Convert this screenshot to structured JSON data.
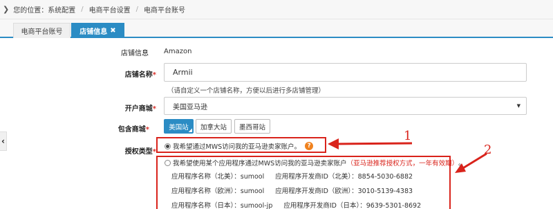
{
  "breadcrumb": {
    "prefix": "您的位置：",
    "items": [
      "系统配置",
      "电商平台设置",
      "电商平台账号"
    ]
  },
  "tabs": [
    {
      "label": "电商平台账号"
    },
    {
      "label": "店铺信息"
    }
  ],
  "form": {
    "platform_label": "店铺信息",
    "platform_value": "Amazon",
    "name_label": "店铺名称",
    "name_value": "Armii",
    "name_hint": "（请自定义一个店铺名称，方便以后进行多店铺管理）",
    "mall_label": "开户商城",
    "mall_value": "美国亚马逊",
    "sites_label": "包含商城",
    "sites": [
      "美国站",
      "加拿大站",
      "墨西哥站"
    ],
    "auth_label": "授权类型",
    "required_mark": "*",
    "auth_option1": "我希望通过MWS访问我的亚马逊卖家账户。",
    "auth_option2": "我希望使用某个应用程序通过MWS访问我的亚马逊卖家账户",
    "auth_option2_note": "（亚马逊推荐授权方式，一年有效期）",
    "auth_option2_end": "。",
    "help_icon": "?",
    "credentials": [
      {
        "name_label": "应用程序名称（北美）：",
        "name": "sumool",
        "dev_label": "应用程序开发商ID（北美）：",
        "dev_id": "8854-5030-6882"
      },
      {
        "name_label": "应用程序名称（欧洲）：",
        "name": "sumool",
        "dev_label": "应用程序开发商ID（欧洲）：",
        "dev_id": "3010-5139-4383"
      },
      {
        "name_label": "应用程序名称（日本）：",
        "name": "sumool-jp",
        "dev_label": "应用程序开发商ID（日本）：",
        "dev_id": "9639-5301-8692"
      }
    ]
  },
  "annotations": [
    "1",
    "2"
  ],
  "colors": {
    "accent": "#2b8cc4",
    "annotation": "#d9231b",
    "help": "#f0821e",
    "required": "#d9322b"
  }
}
